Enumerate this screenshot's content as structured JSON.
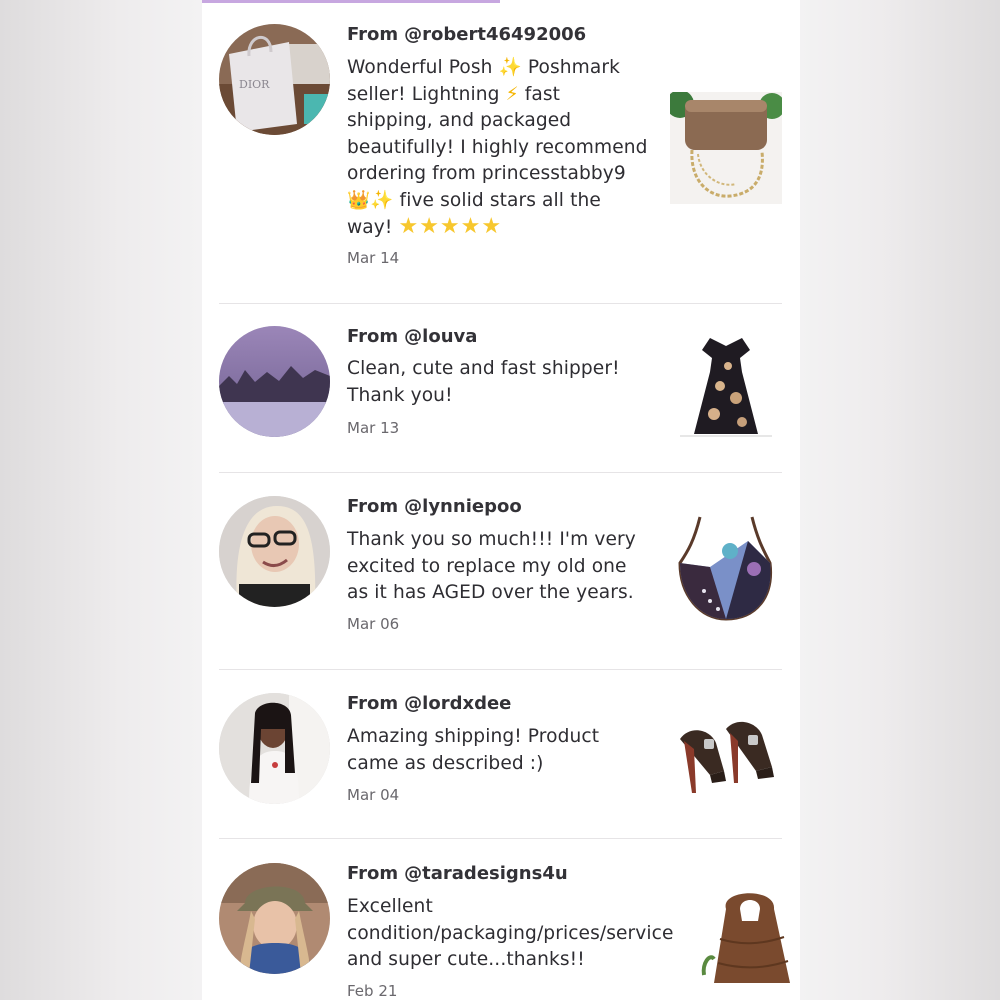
{
  "reviews": [
    {
      "from_prefix": "From",
      "username": "@robert46492006",
      "lines": [
        "Wonderful Posh ",
        "✨",
        " Poshmark",
        "seller! Lightning ",
        "⚡",
        " fast",
        "shipping, and packaged",
        "beautifully! I highly recommend",
        "ordering from princesstabby9",
        "👑",
        "✨",
        " five solid stars all the",
        "way! ",
        "★★★★★"
      ],
      "date": "Mar 14",
      "avatar_label": "DIOR",
      "item": "bronze clutch with chain"
    },
    {
      "from_prefix": "From",
      "username": "@louva",
      "text_line1": "Clean, cute and fast shipper!",
      "text_line2": "Thank you!",
      "date": "Mar 13",
      "item": "black floral dress"
    },
    {
      "from_prefix": "From",
      "username": "@lynniepoo",
      "text_line1": "Thank you so much!!! I'm very",
      "text_line2": "excited to replace my old one",
      "text_line3": "as it has AGED over the years.",
      "date": "Mar 06",
      "item": "patchwork hobo bag"
    },
    {
      "from_prefix": "From",
      "username": "@lordxdee",
      "text_line1": "Amazing shipping! Product",
      "text_line2": "came as described :)",
      "date": "Mar 04",
      "item": "strappy heeled sandals"
    },
    {
      "from_prefix": "From",
      "username": "@taradesigns4u",
      "text_line1": "Excellent",
      "text_line2": "condition/packaging/prices/service",
      "text_line3": "and super cute...thanks!!",
      "date": "Feb 21",
      "item": "brown leather handbag"
    }
  ],
  "colors": {
    "accent": "#c7a7e0",
    "text": "#2e2d32",
    "muted": "#6a686d",
    "divider": "#e6e4e6"
  }
}
